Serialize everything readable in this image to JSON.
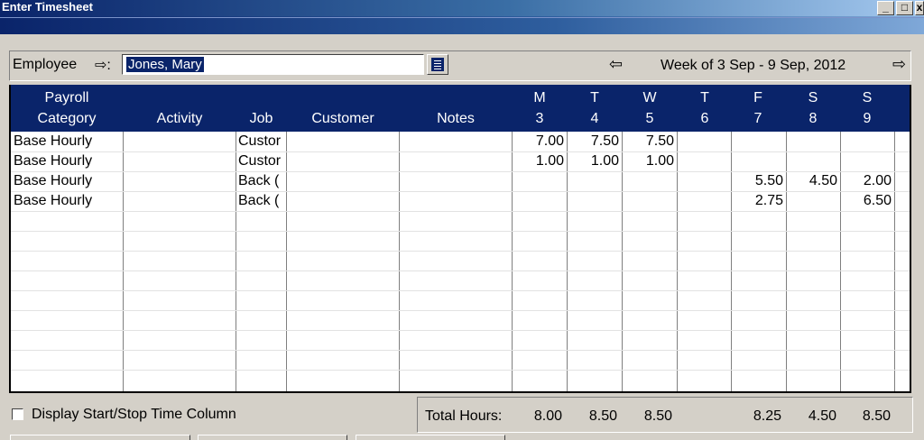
{
  "window": {
    "title": "Enter Timesheet"
  },
  "employee": {
    "label": "Employee",
    "value": "Jones, Mary"
  },
  "week": {
    "label": "Week of 3 Sep - 9 Sep, 2012"
  },
  "columns": {
    "payroll_line1": "Payroll",
    "payroll_line2": "Category",
    "activity": "Activity",
    "job": "Job",
    "customer": "Customer",
    "notes": "Notes",
    "days": [
      {
        "letter": "M",
        "date": "3"
      },
      {
        "letter": "T",
        "date": "4"
      },
      {
        "letter": "W",
        "date": "5"
      },
      {
        "letter": "T",
        "date": "6"
      },
      {
        "letter": "F",
        "date": "7"
      },
      {
        "letter": "S",
        "date": "8"
      },
      {
        "letter": "S",
        "date": "9"
      }
    ]
  },
  "rows": [
    {
      "category": "Base Hourly",
      "activity": "",
      "job": "Custor",
      "customer": "",
      "notes": "",
      "hours": [
        "7.00",
        "7.50",
        "7.50",
        "",
        "",
        "",
        ""
      ]
    },
    {
      "category": "Base Hourly",
      "activity": "",
      "job": "Custor",
      "customer": "",
      "notes": "",
      "hours": [
        "1.00",
        "1.00",
        "1.00",
        "",
        "",
        "",
        ""
      ]
    },
    {
      "category": "Base Hourly",
      "activity": "",
      "job": "Back (",
      "customer": "",
      "notes": "",
      "hours": [
        "",
        "",
        "",
        "",
        "5.50",
        "4.50",
        "2.00"
      ]
    },
    {
      "category": "Base Hourly",
      "activity": "",
      "job": "Back (",
      "customer": "",
      "notes": "",
      "hours": [
        "",
        "",
        "",
        "",
        "2.75",
        "",
        "6.50"
      ]
    }
  ],
  "footer": {
    "checkbox_label": "Display Start/Stop Time Column",
    "totals_label": "Total Hours:",
    "totals": [
      "8.00",
      "8.50",
      "8.50",
      "",
      "8.25",
      "4.50",
      "8.50"
    ]
  },
  "icons": {
    "employee_arrow": "right-arrow-icon",
    "prev_week": "left-arrow-icon",
    "next_week": "right-arrow-icon",
    "dropdown": "list-icon"
  },
  "colors": {
    "header_bg": "#0a246a",
    "window_bg": "#d4d0c8"
  }
}
